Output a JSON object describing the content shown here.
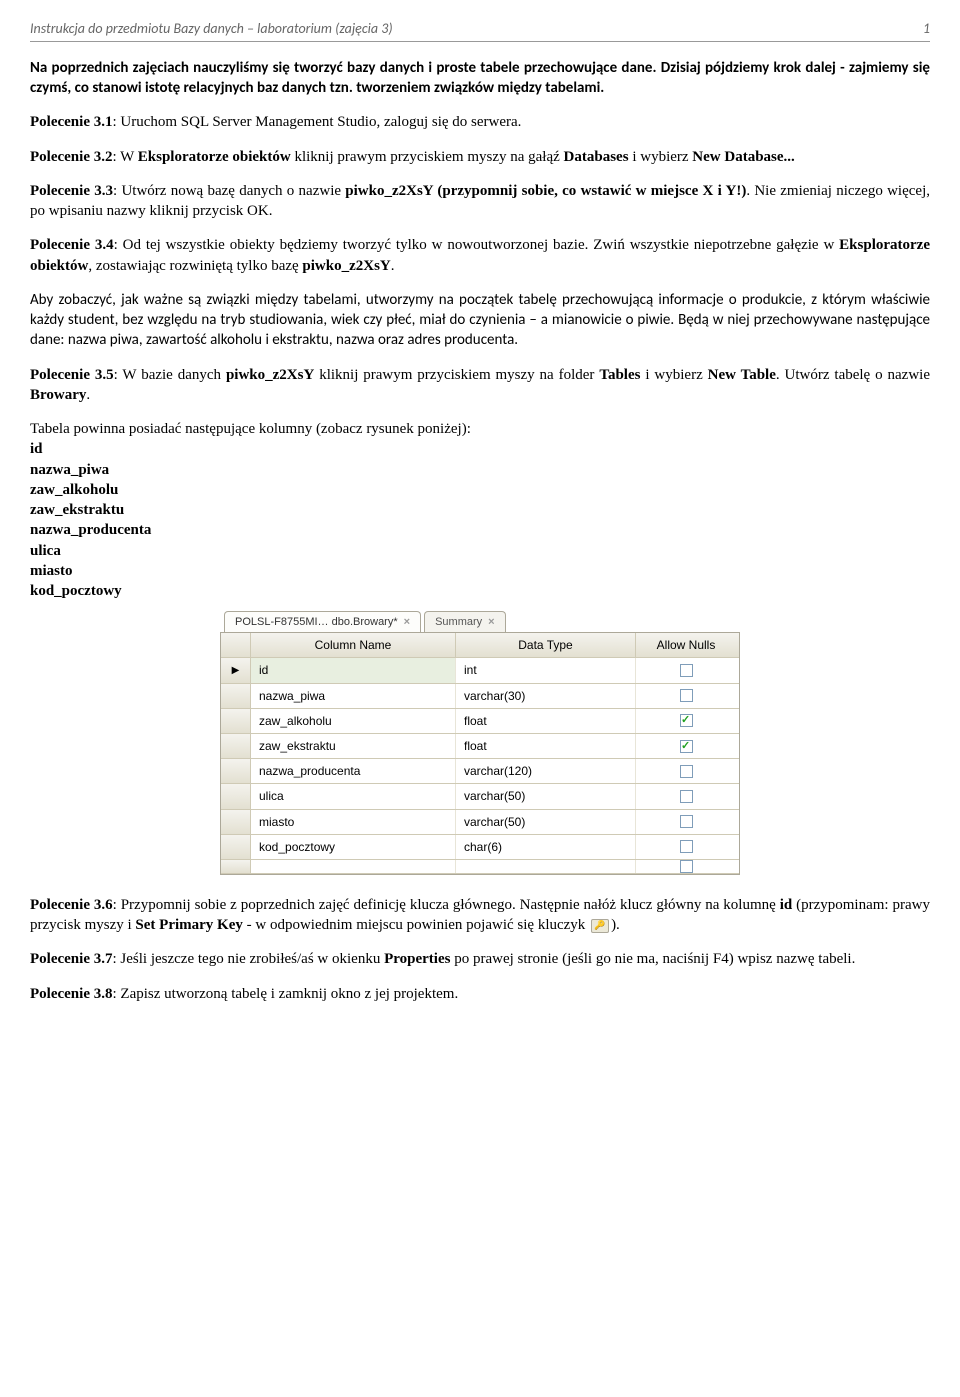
{
  "header": {
    "title": "Instrukcja do przedmiotu Bazy danych – laboratorium (zajęcia 3)",
    "pageno": "1"
  },
  "intro": "Na poprzednich zajęciach nauczyliśmy się tworzyć bazy danych i proste tabele przechowujące dane. Dzisiaj pójdziemy krok dalej - zajmiemy się czymś, co stanowi istotę relacyjnych baz danych tzn. tworzeniem związków między tabelami.",
  "p31": {
    "label": "Polecenie 3.1",
    "text": ": Uruchom SQL Server Management Studio, zaloguj się do serwera."
  },
  "p32": {
    "label": "Polecenie 3.2",
    "t1": ": W ",
    "b1": "Eksploratorze obiektów",
    "t2": " kliknij prawym przyciskiem myszy na gałąź ",
    "b2": "Databases",
    "t3": " i wybierz ",
    "b3": "New Database...",
    "t4": ""
  },
  "p33": {
    "label": "Polecenie 3.3",
    "t1": ": Utwórz nową bazę danych o nazwie ",
    "b1": "piwko_z2XsY (przypomnij sobie, co wstawić w miejsce X i Y!)",
    "t2": ". Nie zmieniaj niczego więcej, po wpisaniu nazwy kliknij przycisk OK."
  },
  "p34": {
    "label": "Polecenie 3.4",
    "t1": ": Od tej wszystkie obiekty będziemy tworzyć tylko w nowoutworzonej bazie. Zwiń wszystkie niepotrzebne gałęzie w ",
    "b1": "Eksploratorze obiektów",
    "t2": ", zostawiając rozwiniętą tylko bazę ",
    "b2": "piwko_z2XsY",
    "t3": "."
  },
  "about": "Aby zobaczyć, jak ważne są związki między tabelami, utworzymy na początek tabelę przechowującą informacje o produkcie, z którym właściwie każdy student, bez względu na tryb studiowania, wiek czy płeć, miał do czynienia – a mianowicie o piwie. Będą w niej przechowywane następujące dane: nazwa piwa, zawartość alkoholu i ekstraktu, nazwa oraz adres producenta.",
  "p35": {
    "label": "Polecenie 3.5",
    "t1": ": W bazie danych ",
    "b1": "piwko_z2XsY",
    "t2": " kliknij prawym przyciskiem myszy na folder ",
    "b2": "Tables",
    "t3": " i wybierz ",
    "b3": "New Table",
    "t4": ". Utwórz tabelę o nazwie ",
    "b4": "Browary",
    "t5": "."
  },
  "colsIntro": "Tabela powinna posiadać następujące kolumny (zobacz rysunek poniżej):",
  "cols": [
    "id",
    "nazwa_piwa",
    "zaw_alkoholu",
    "zaw_ekstraktu",
    "nazwa_producenta",
    "ulica",
    "miasto",
    "kod_pocztowy"
  ],
  "designer": {
    "tab1": "POLSL-F8755MI… dbo.Browary*",
    "tab2": "Summary",
    "headers": {
      "col": "Column Name",
      "type": "Data Type",
      "nulls": "Allow Nulls"
    },
    "rows": [
      {
        "name": "id",
        "type": "int",
        "nulls": false,
        "selected": true
      },
      {
        "name": "nazwa_piwa",
        "type": "varchar(30)",
        "nulls": false
      },
      {
        "name": "zaw_alkoholu",
        "type": "float",
        "nulls": true
      },
      {
        "name": "zaw_ekstraktu",
        "type": "float",
        "nulls": true
      },
      {
        "name": "nazwa_producenta",
        "type": "varchar(120)",
        "nulls": false
      },
      {
        "name": "ulica",
        "type": "varchar(50)",
        "nulls": false
      },
      {
        "name": "miasto",
        "type": "varchar(50)",
        "nulls": false
      },
      {
        "name": "kod_pocztowy",
        "type": "char(6)",
        "nulls": false
      }
    ]
  },
  "p36": {
    "label": "Polecenie 3.6",
    "t1": ": Przypomnij sobie z poprzednich zajęć definicję klucza głównego. Następnie nałóż klucz główny na kolumnę ",
    "b1": "id",
    "t2": " (przypominam: prawy przycisk myszy i ",
    "b2": "Set Primary Key",
    "t3": " - w odpowiednim miejscu powinien pojawić się kluczyk ",
    "t4": ")."
  },
  "p37": {
    "label": "Polecenie 3.7",
    "t1": ": Jeśli jeszcze tego nie zrobiłeś/aś w okienku ",
    "b1": "Properties",
    "t2": " po prawej stronie (jeśli go nie ma, naciśnij F4) wpisz nazwę tabeli."
  },
  "p38": {
    "label": "Polecenie 3.8",
    "text": ": Zapisz utworzoną tabelę i zamknij okno z jej projektem."
  }
}
